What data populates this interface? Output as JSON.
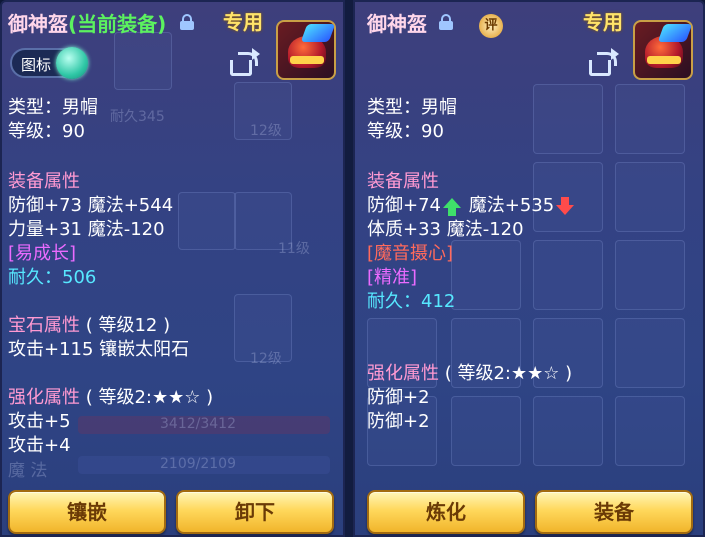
{
  "left_panel": {
    "title": "御神盔",
    "title_tag": "(当前装备)",
    "exclusive_label": "专用",
    "toggle_label": "图标",
    "type": "类型：男帽",
    "level": "等级：90",
    "equip_header": "装备属性",
    "attr_line1": "防御+73 魔法+544",
    "attr_line2": "力量+31 魔法-120",
    "special": "[易成长]",
    "durability": "耐久：506",
    "gem_header": "宝石属性",
    "gem_level": "( 等级12 )",
    "gem_line": "攻击+115 镶嵌太阳石",
    "enhance_header": "强化属性",
    "enhance_level": "( 等级2:★★☆ )",
    "enhance_line1": "攻击+5",
    "enhance_line2": "攻击+4",
    "button_inlay": "镶嵌",
    "button_unequip": "卸下"
  },
  "right_panel": {
    "title": "御神盔",
    "rate_badge": "评",
    "exclusive_label": "专用",
    "type": "类型：男帽",
    "level": "等级：90",
    "equip_header": "装备属性",
    "attr_a": "防御+74",
    "attr_b": "魔法+535",
    "attr_line2": "体质+33 魔法-120",
    "special1": "[魔音摄心]",
    "special2": "[精准]",
    "durability": "耐久：412",
    "enhance_header": "强化属性",
    "enhance_level": "( 等级2:★★☆ )",
    "enhance_line1": "防御+2",
    "enhance_line2": "防御+2",
    "button_refine": "炼化",
    "button_equip": "装备"
  },
  "background_ghost_text": {
    "level_a": "12级",
    "level_b": "11级",
    "level_c": "12级",
    "durability_ghost": "耐久345",
    "hp_bar": "3412/3412",
    "mp_label": "魔 法",
    "mp_bar": "2109/2109"
  },
  "icons": {
    "lock": "lock-icon",
    "share": "share-icon",
    "helmet": "helmet-item-icon",
    "up_arrow": "arrow-up-icon",
    "down_arrow": "arrow-down-icon"
  },
  "colors": {
    "panel_bg": "#344283",
    "title": "#ffd6ea",
    "tag": "#5cf25f",
    "section": "#ff9ad2",
    "purple": "#ea6bff",
    "cyan": "#57e8ff",
    "button": "#ffd85c",
    "up": "#3fe06a",
    "down": "#ff4b4b"
  }
}
